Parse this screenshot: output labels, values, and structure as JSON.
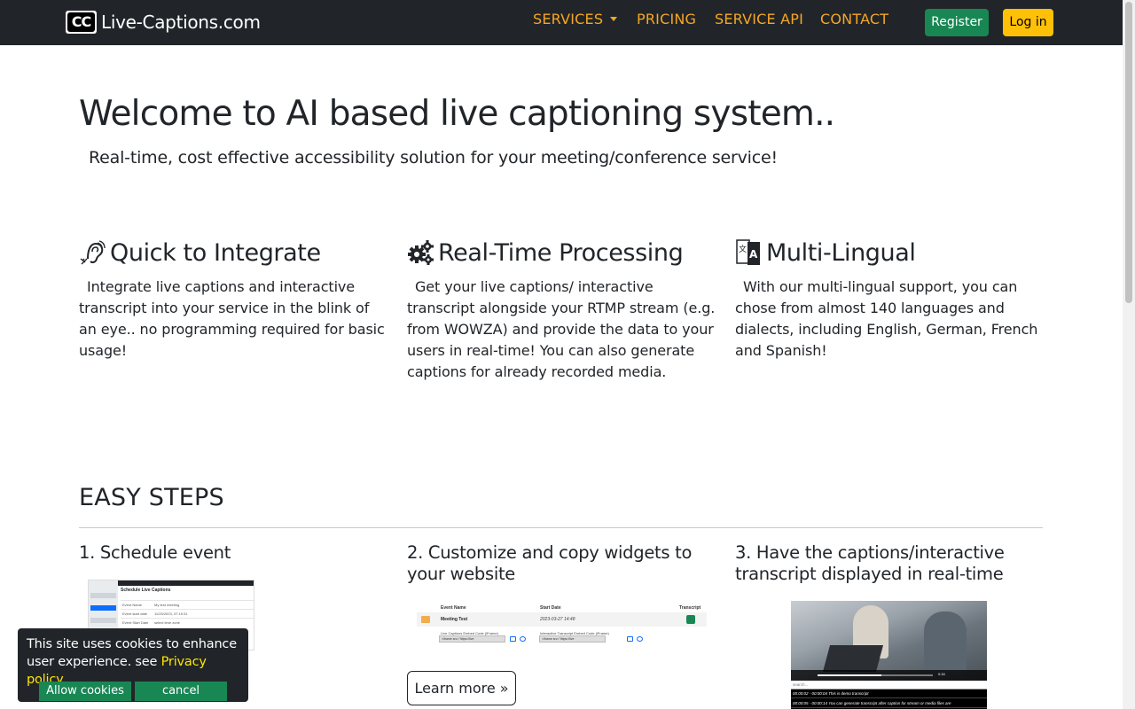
{
  "navbar": {
    "brand_logo": "CC",
    "brand_name": "Live-Captions.com",
    "links": {
      "services": "SERVICES",
      "pricing": "PRICING",
      "service_api": "SERVICE API",
      "contact": "CONTACT"
    },
    "register_label": "Register",
    "login_label": "Log in",
    "colors": {
      "bg": "#212529",
      "link": "#f5a623",
      "register": "#198754",
      "login": "#ffc107"
    }
  },
  "hero": {
    "title": "Welcome to AI based live captioning system..",
    "subtitle": "Real-time, cost effective accessibility solution for your meeting/conference service!"
  },
  "features": [
    {
      "icon": "ear-icon",
      "title": "Quick to Integrate",
      "text": "Integrate live captions and interactive transcript into your service in the blink of an eye.. no programming required for basic usage!"
    },
    {
      "icon": "gears-icon",
      "title": "Real-Time Processing",
      "text": "Get your live captions/ interactive transcript alongside your RTMP stream (e.g. from WOWZA) and provide the data to your users in real-time! You can also generate captions for already recorded media."
    },
    {
      "icon": "translate-icon",
      "title": "Multi-Lingual",
      "text": "With our multi-lingual support, you can chose from almost 140 languages and dialects, including English, German, French and Spanish!"
    }
  ],
  "steps": {
    "title": "EASY STEPS",
    "items": [
      {
        "title": "1. Schedule event"
      },
      {
        "title": "2. Customize and copy widgets to your website"
      },
      {
        "title": "3. Have the captions/interactive transcript displayed in real-time"
      }
    ],
    "learn_more": "Learn more »"
  },
  "thumb_schedule": {
    "heading": "Schedule Live Captions",
    "fields": [
      {
        "label": "Event Name",
        "value": "My test meeting"
      },
      {
        "label": "Event start date",
        "value": "11/25/2023, 07:15:31"
      },
      {
        "label": "Event Start Date",
        "value": "select time zone"
      }
    ]
  },
  "thumb_widgets": {
    "col_event": "Event Name",
    "col_start": "Start Date",
    "col_transcript": "Transcript",
    "event_name": "Meeting Test",
    "event_date": "2023-03-27 14:48",
    "embed_captions_label": "Live Captions Embed Code (iFrame)",
    "embed_transcript_label": "Interactive Transcript Embed Code (iFrame)",
    "embed_captions_value": "<iframe src=\"https://live",
    "embed_transcript_value": "<iframe src=\"https://live"
  },
  "thumb_transcript": {
    "time": "0:16",
    "search_placeholder": "search...",
    "lines": [
      "00:00:02 - 00:00:04 This is demo transcript",
      "00:00:05 - 00:00:14 You can generate transcript after caption for stream or media files are"
    ]
  },
  "cookie": {
    "text": "This site uses cookies to enhance user experience. see",
    "link": "Privacy policy",
    "allow_label": "Allow cookies",
    "cancel_label": "cancel"
  }
}
